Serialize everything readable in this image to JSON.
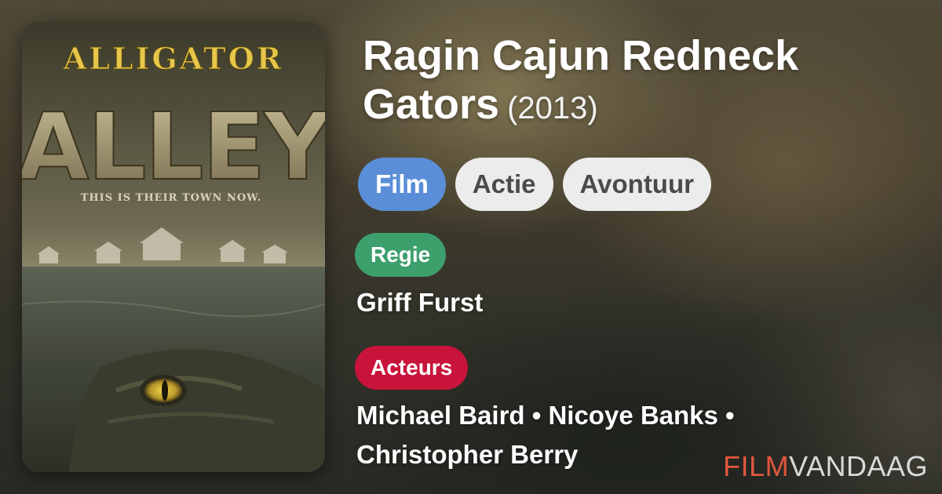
{
  "movie": {
    "title": "Ragin Cajun Redneck Gators",
    "year": "(2013)"
  },
  "genres": [
    {
      "label": "Film",
      "style": "primary",
      "color": "#5a8ed8"
    },
    {
      "label": "Actie",
      "style": "secondary"
    },
    {
      "label": "Avontuur",
      "style": "secondary"
    }
  ],
  "director": {
    "label": "Regie",
    "color": "#3d9f6c",
    "name": "Griff Furst"
  },
  "cast": {
    "label": "Acteurs",
    "color": "#c8143a",
    "line1": "Michael Baird • Nicoye Banks •",
    "line2": "Christopher Berry"
  },
  "poster": {
    "title_top": "ALLIGATOR",
    "title_main": "ALLEY",
    "tagline": "THIS IS THEIR TOWN NOW."
  },
  "brand": {
    "part1": "FILM",
    "part2": "VANDAAG",
    "color_part1": "#e0573e"
  }
}
